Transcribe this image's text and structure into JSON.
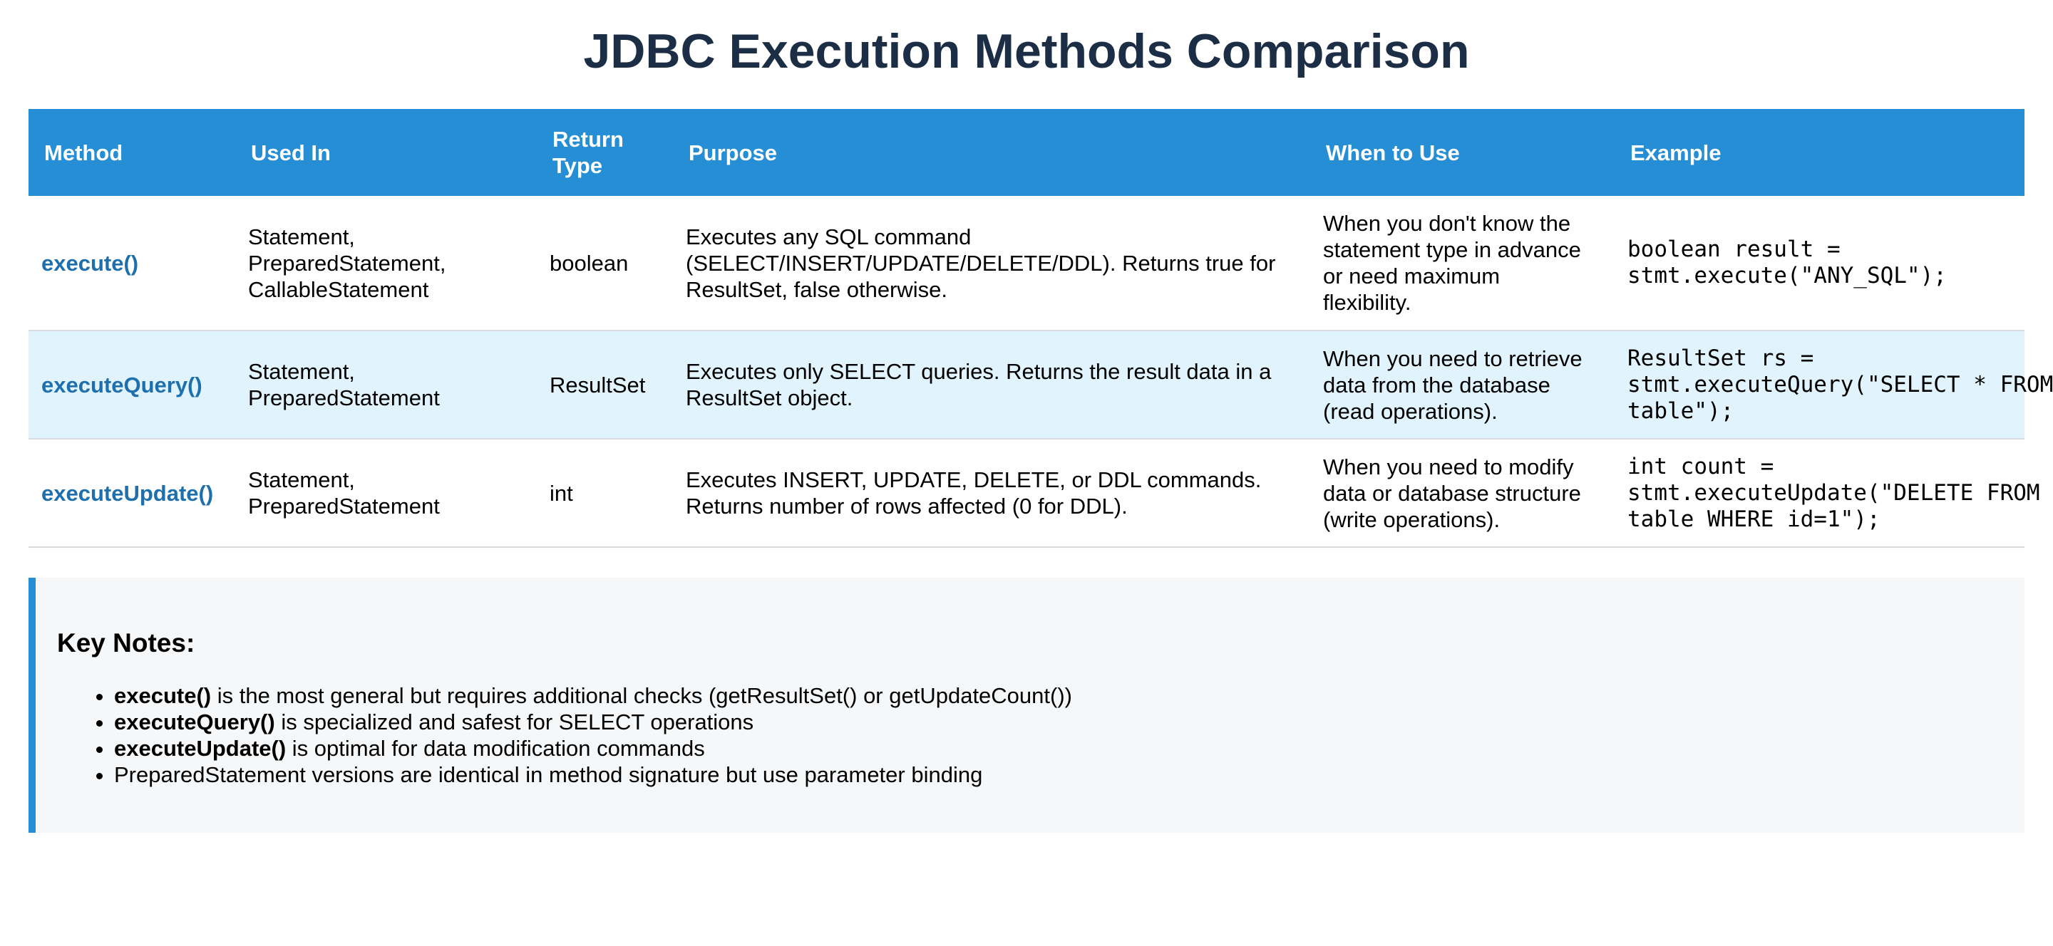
{
  "title": "JDBC Execution Methods Comparison",
  "table": {
    "headers": [
      "Method",
      "Used In",
      "Return\nType",
      "Purpose",
      "When to Use",
      "Example"
    ],
    "rows": [
      {
        "method": "execute()",
        "used_in": "Statement,\nPreparedStatement,\nCallableStatement",
        "return_type": "boolean",
        "purpose": "Executes any SQL command\n(SELECT/INSERT/UPDATE/DELETE/DDL). Returns true for\nResultSet, false otherwise.",
        "when": "When you don't know the\nstatement type in advance\nor need maximum\nflexibility.",
        "example": "boolean result =\nstmt.execute(\"ANY_SQL\");"
      },
      {
        "method": "executeQuery()",
        "used_in": "Statement,\nPreparedStatement",
        "return_type": "ResultSet",
        "purpose": "Executes only SELECT queries. Returns the result data in a\nResultSet object.",
        "when": "When you need to retrieve\ndata from the database\n(read operations).",
        "example": "ResultSet rs =\nstmt.executeQuery(\"SELECT * FROM\ntable\");"
      },
      {
        "method": "executeUpdate()",
        "used_in": "Statement,\nPreparedStatement",
        "return_type": "int",
        "purpose": "Executes INSERT, UPDATE, DELETE, or DDL commands.\nReturns number of rows affected (0 for DDL).",
        "when": "When you need to modify\ndata or database structure\n(write operations).",
        "example": "int count =\nstmt.executeUpdate(\"DELETE FROM\ntable WHERE id=1\");"
      }
    ]
  },
  "notes": {
    "heading": "Key Notes:",
    "items": [
      {
        "bold": "execute()",
        "text": " is the most general but requires additional checks (getResultSet() or getUpdateCount())"
      },
      {
        "bold": "executeQuery()",
        "text": " is specialized and safest for SELECT operations"
      },
      {
        "bold": "executeUpdate()",
        "text": " is optimal for data modification commands"
      },
      {
        "bold": "",
        "text": "PreparedStatement versions are identical in method signature but use parameter binding"
      }
    ]
  },
  "colors": {
    "title": "#1c2e45",
    "header_bg": "#268ed4",
    "method_link": "#1e6fad",
    "alt_row_bg": "#e1f3fc",
    "notes_bg": "#f5f7f9",
    "notes_accent": "#268ed4"
  }
}
